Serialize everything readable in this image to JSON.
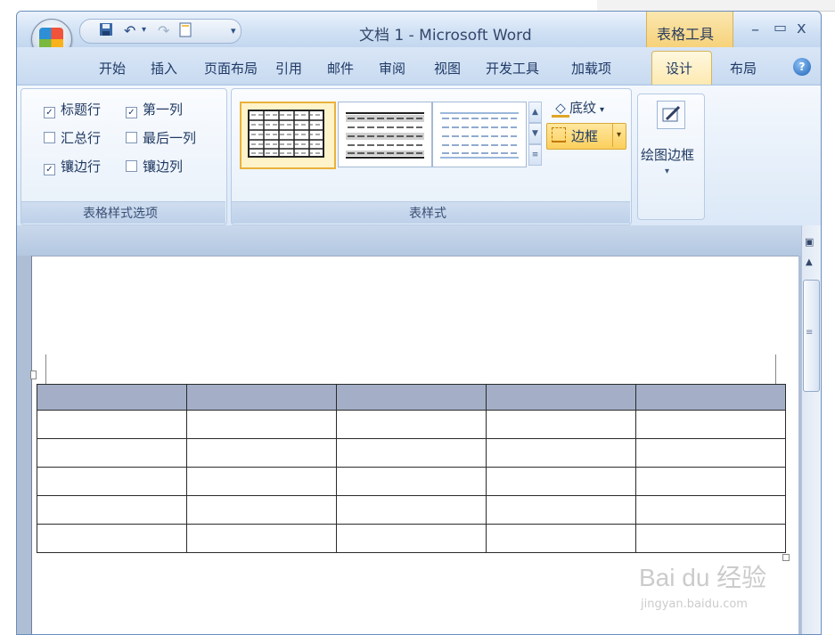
{
  "window": {
    "title": "文档 1 - Microsoft Word",
    "contextual_tab_group": "表格工具",
    "controls": [
      "–",
      "▭",
      "x"
    ]
  },
  "tabs": [
    "开始",
    "插入",
    "页面布局",
    "引用",
    "邮件",
    "审阅",
    "视图",
    "开发工具",
    "加载项",
    "设计",
    "布局"
  ],
  "active_tab": "设计",
  "table_style_options": {
    "group_label": "表格样式选项",
    "items": [
      {
        "label": "标题行",
        "checked": true
      },
      {
        "label": "第一列",
        "checked": true
      },
      {
        "label": "汇总行",
        "checked": false
      },
      {
        "label": "最后一列",
        "checked": false
      },
      {
        "label": "镶边行",
        "checked": true
      },
      {
        "label": "镶边列",
        "checked": false
      }
    ]
  },
  "table_styles": {
    "group_label": "表样式",
    "shading_label": "底纹",
    "borders_label": "边框"
  },
  "draw_borders": {
    "label": "绘图边框"
  },
  "document_table": {
    "rows": 6,
    "cols": 5,
    "header_color": "#a4afc7"
  },
  "watermark": {
    "brand": "Bai du 经验",
    "url": "jingyan.baidu.com"
  },
  "colors": {
    "ribbon_accent": "#fde9b0",
    "selected_border": "#e9b23a"
  }
}
